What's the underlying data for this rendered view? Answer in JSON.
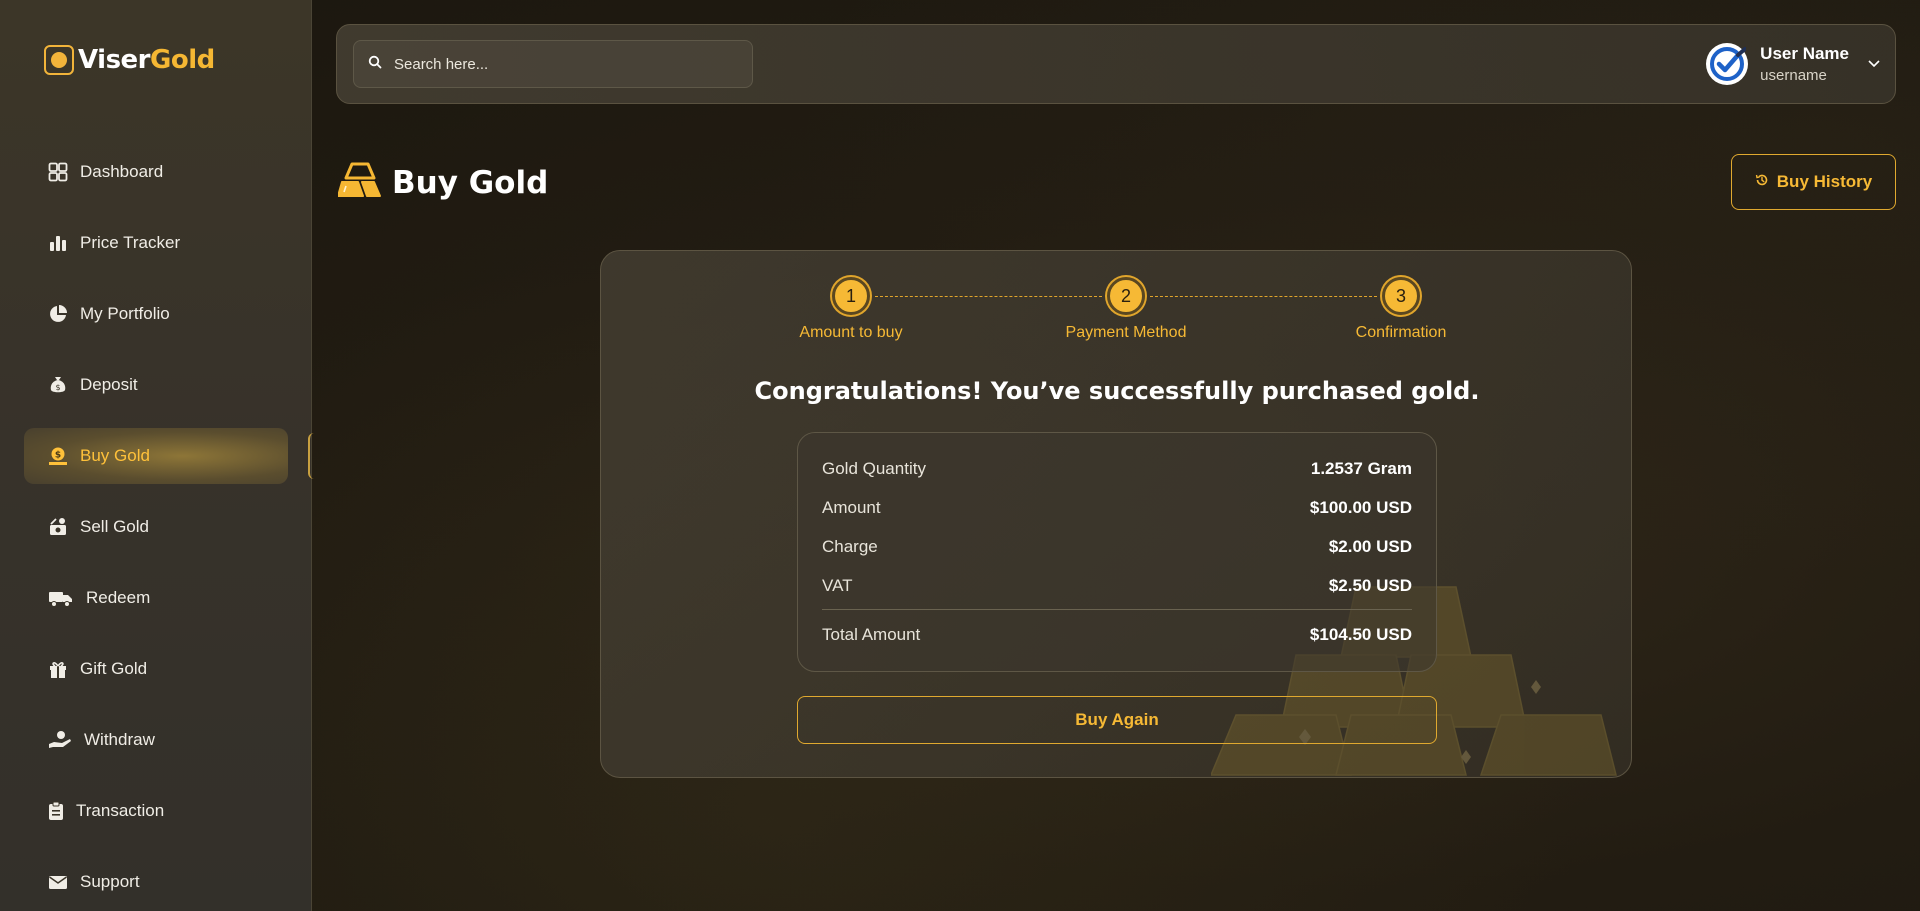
{
  "brand": {
    "name_part1": "Viser",
    "name_part2": "Gold"
  },
  "colors": {
    "accent": "#f6b935",
    "sidebar_bg": "#3a3428",
    "page_bg": "#221c12"
  },
  "sidebar": {
    "items": [
      {
        "label": "Dashboard",
        "icon": "dashboard-icon",
        "active": false
      },
      {
        "label": "Price Tracker",
        "icon": "bar-chart-icon",
        "active": false
      },
      {
        "label": "My Portfolio",
        "icon": "pie-chart-icon",
        "active": false
      },
      {
        "label": "Deposit",
        "icon": "money-bag-icon",
        "active": false
      },
      {
        "label": "Buy Gold",
        "icon": "coin-hand-icon",
        "active": true
      },
      {
        "label": "Sell Gold",
        "icon": "sell-cash-icon",
        "active": false
      },
      {
        "label": "Redeem",
        "icon": "truck-icon",
        "active": false
      },
      {
        "label": "Gift Gold",
        "icon": "gift-icon",
        "active": false
      },
      {
        "label": "Withdraw",
        "icon": "withdraw-hand-icon",
        "active": false
      },
      {
        "label": "Transaction",
        "icon": "clipboard-icon",
        "active": false
      },
      {
        "label": "Support",
        "icon": "envelope-icon",
        "active": false
      }
    ]
  },
  "header": {
    "search_placeholder": "Search here...",
    "user_name": "User Name",
    "user_handle": "username"
  },
  "page": {
    "title": "Buy Gold",
    "history_button": "Buy History"
  },
  "steps": [
    {
      "number": "1",
      "label": "Amount to buy"
    },
    {
      "number": "2",
      "label": "Payment Method"
    },
    {
      "number": "3",
      "label": "Confirmation"
    }
  ],
  "result": {
    "message": "Congratulations! You’ve successfully purchased gold.",
    "rows": [
      {
        "label": "Gold Quantity",
        "value": "1.2537 Gram"
      },
      {
        "label": "Amount",
        "value": "$100.00 USD"
      },
      {
        "label": "Charge",
        "value": "$2.00 USD"
      },
      {
        "label": "VAT",
        "value": "$2.50 USD"
      }
    ],
    "total": {
      "label": "Total Amount",
      "value": "$104.50 USD"
    },
    "buy_again": "Buy Again"
  }
}
